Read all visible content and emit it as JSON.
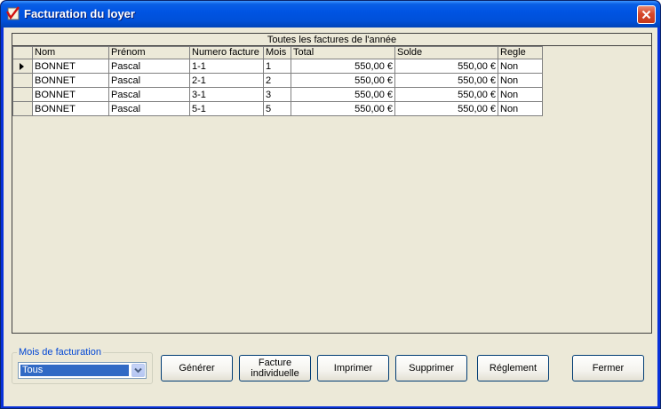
{
  "window": {
    "title": "Facturation du loyer"
  },
  "grid": {
    "caption": "Toutes les factures de l'année",
    "columns": [
      "Nom",
      "Prénom",
      "Numero facture",
      "Mois",
      "Total",
      "Solde",
      "Regle"
    ],
    "rows": [
      [
        "BONNET",
        "Pascal",
        "1-1",
        "1",
        "550,00 €",
        "550,00 €",
        "Non"
      ],
      [
        "BONNET",
        "Pascal",
        "2-1",
        "2",
        "550,00 €",
        "550,00 €",
        "Non"
      ],
      [
        "BONNET",
        "Pascal",
        "3-1",
        "3",
        "550,00 €",
        "550,00 €",
        "Non"
      ],
      [
        "BONNET",
        "Pascal",
        "5-1",
        "5",
        "550,00 €",
        "550,00 €",
        "Non"
      ]
    ]
  },
  "filter": {
    "legend": "Mois de facturation",
    "selected": "Tous"
  },
  "buttons": {
    "generate": "Générer",
    "individual_line1": "Facture",
    "individual_line2": "individuelle",
    "print": "Imprimer",
    "delete": "Supprimer",
    "payment": "Réglement",
    "close": "Fermer"
  },
  "colors": {
    "titlebar": "#0054e3",
    "selection": "#316ac5",
    "group_legend": "#0046d5",
    "window_bg": "#ece9d8"
  },
  "icons": {
    "app": "checkmark-app-icon",
    "close": "close-icon",
    "row_indicator": "row-pointer-icon",
    "dropdown": "chevron-down-icon"
  }
}
